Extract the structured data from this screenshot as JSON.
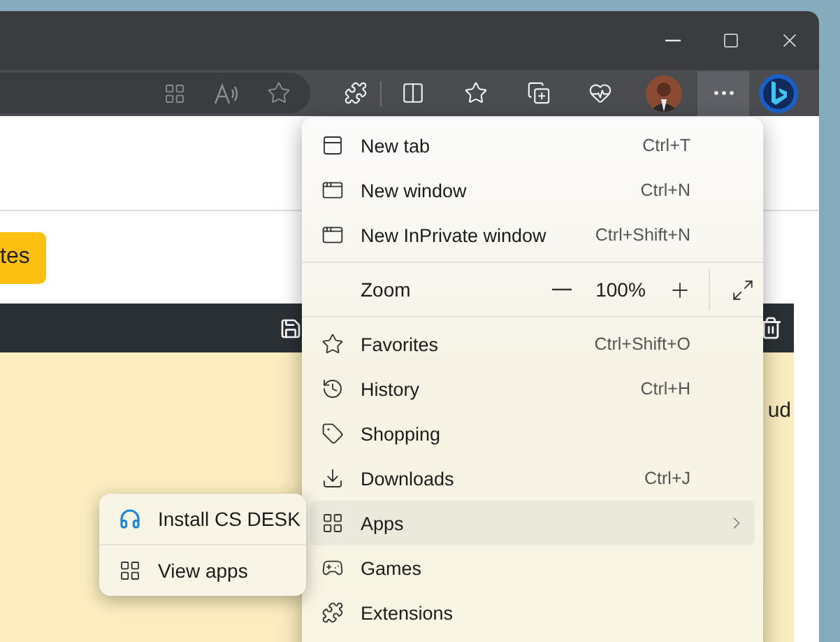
{
  "toolbar": {
    "more_button": {
      "pressed": true
    }
  },
  "page": {
    "button": "tes",
    "side_text": "ud"
  },
  "menu": {
    "items": [
      {
        "kind": "item",
        "label": "New tab",
        "shortcut": "Ctrl+T",
        "selected": false,
        "submenu": false
      },
      {
        "kind": "item",
        "label": "New window",
        "shortcut": "Ctrl+N",
        "selected": false,
        "submenu": false
      },
      {
        "kind": "item",
        "label": "New InPrivate window",
        "shortcut": "Ctrl+Shift+N",
        "selected": false,
        "submenu": false
      },
      {
        "kind": "separator"
      },
      {
        "kind": "zoom",
        "label": "Zoom",
        "value": "100%"
      },
      {
        "kind": "separator"
      },
      {
        "kind": "item",
        "label": "Favorites",
        "shortcut": "Ctrl+Shift+O",
        "selected": false,
        "submenu": false
      },
      {
        "kind": "item",
        "label": "History",
        "shortcut": "Ctrl+H",
        "selected": false,
        "submenu": false
      },
      {
        "kind": "item",
        "label": "Shopping",
        "selected": false,
        "submenu": false
      },
      {
        "kind": "item",
        "label": "Downloads",
        "shortcut": "Ctrl+J",
        "selected": false,
        "submenu": false
      },
      {
        "kind": "item",
        "label": "Apps",
        "selected": true,
        "submenu": true
      },
      {
        "kind": "item",
        "label": "Games",
        "selected": false,
        "submenu": false
      },
      {
        "kind": "item",
        "label": "Extensions",
        "selected": false,
        "submenu": false
      }
    ]
  },
  "submenu": {
    "items": [
      {
        "label": "Install CS DESK",
        "selected": false
      },
      {
        "label": "View apps",
        "selected": false
      }
    ]
  }
}
